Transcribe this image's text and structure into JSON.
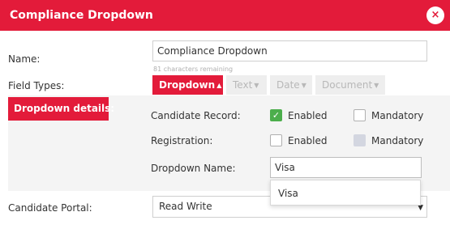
{
  "dialog": {
    "title": "Compliance Dropdown",
    "close_label": "×"
  },
  "form": {
    "name_label": "Name:",
    "name_value": "Compliance Dropdown",
    "name_helper": "81 characters remaining",
    "field_types_label": "Field Types:",
    "field_types": [
      {
        "label": "Dropdown",
        "active": true
      },
      {
        "label": "Text",
        "active": false
      },
      {
        "label": "Date",
        "active": false
      },
      {
        "label": "Document",
        "active": false
      }
    ],
    "candidate_portal_label": "Candidate Portal:",
    "candidate_portal_value": "Read Write"
  },
  "dropdown_details": {
    "heading": "Dropdown details:",
    "candidate_record_label": "Candidate Record:",
    "registration_label": "Registration:",
    "dropdown_name_label": "Dropdown Name:",
    "enabled_label": "Enabled",
    "mandatory_label": "Mandatory",
    "candidate_record_enabled": true,
    "candidate_record_mandatory": false,
    "registration_enabled": false,
    "registration_mandatory": false,
    "dropdown_name_value": "Visa",
    "suggestions": [
      "Visa"
    ]
  },
  "colors": {
    "accent": "#e31b3a",
    "checked": "#4cae4c"
  }
}
